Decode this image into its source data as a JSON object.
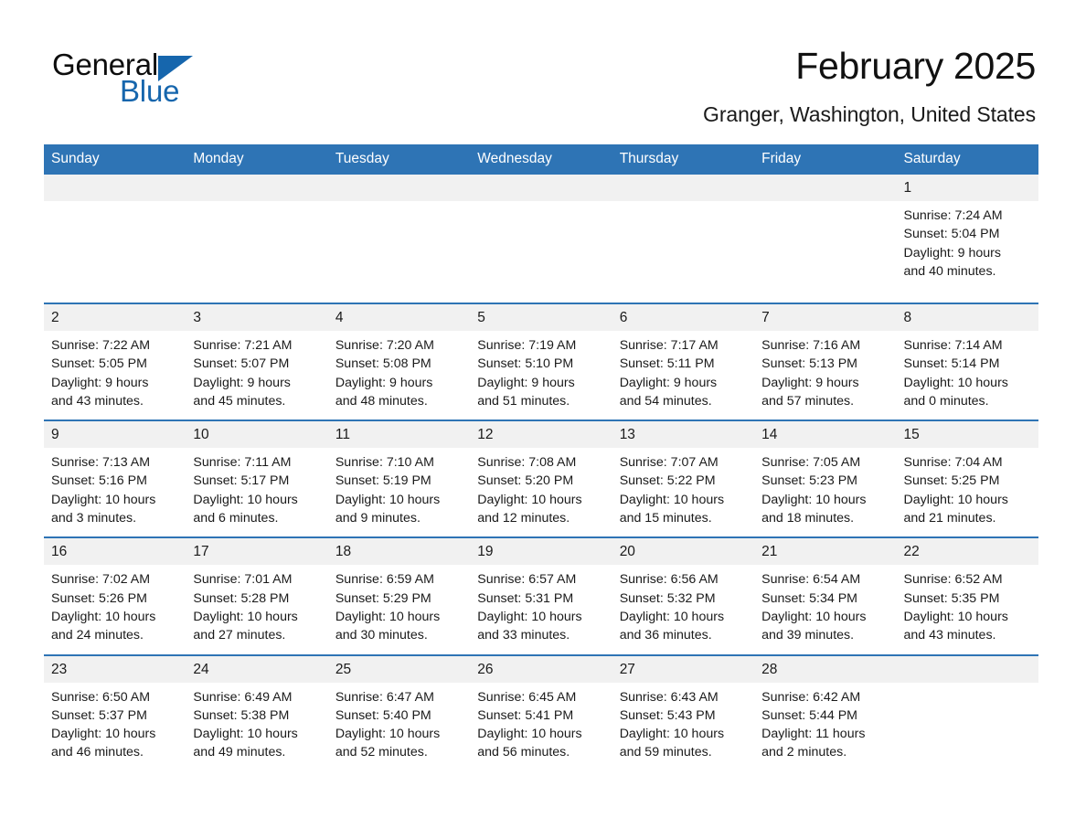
{
  "brand": {
    "name_part1": "General",
    "name_part2": "Blue",
    "triangle_color": "#1666ad"
  },
  "header": {
    "title": "February 2025",
    "subtitle": "Granger, Washington, United States"
  },
  "theme": {
    "header_blue": "#2e74b5",
    "daynum_gray": "#f1f1f1",
    "text": "#1a1a1a"
  },
  "weekday_headers": [
    "Sunday",
    "Monday",
    "Tuesday",
    "Wednesday",
    "Thursday",
    "Friday",
    "Saturday"
  ],
  "labels": {
    "sunrise_prefix": "Sunrise:",
    "sunset_prefix": "Sunset:",
    "daylight_prefix": "Daylight:"
  },
  "weeks": [
    [
      {
        "day": "",
        "blank": true
      },
      {
        "day": "",
        "blank": true
      },
      {
        "day": "",
        "blank": true
      },
      {
        "day": "",
        "blank": true
      },
      {
        "day": "",
        "blank": true
      },
      {
        "day": "",
        "blank": true
      },
      {
        "day": "1",
        "sunrise": "Sunrise: 7:24 AM",
        "sunset": "Sunset: 5:04 PM",
        "daylight_line1": "Daylight: 9 hours",
        "daylight_line2": "and 40 minutes."
      }
    ],
    [
      {
        "day": "2",
        "sunrise": "Sunrise: 7:22 AM",
        "sunset": "Sunset: 5:05 PM",
        "daylight_line1": "Daylight: 9 hours",
        "daylight_line2": "and 43 minutes."
      },
      {
        "day": "3",
        "sunrise": "Sunrise: 7:21 AM",
        "sunset": "Sunset: 5:07 PM",
        "daylight_line1": "Daylight: 9 hours",
        "daylight_line2": "and 45 minutes."
      },
      {
        "day": "4",
        "sunrise": "Sunrise: 7:20 AM",
        "sunset": "Sunset: 5:08 PM",
        "daylight_line1": "Daylight: 9 hours",
        "daylight_line2": "and 48 minutes."
      },
      {
        "day": "5",
        "sunrise": "Sunrise: 7:19 AM",
        "sunset": "Sunset: 5:10 PM",
        "daylight_line1": "Daylight: 9 hours",
        "daylight_line2": "and 51 minutes."
      },
      {
        "day": "6",
        "sunrise": "Sunrise: 7:17 AM",
        "sunset": "Sunset: 5:11 PM",
        "daylight_line1": "Daylight: 9 hours",
        "daylight_line2": "and 54 minutes."
      },
      {
        "day": "7",
        "sunrise": "Sunrise: 7:16 AM",
        "sunset": "Sunset: 5:13 PM",
        "daylight_line1": "Daylight: 9 hours",
        "daylight_line2": "and 57 minutes."
      },
      {
        "day": "8",
        "sunrise": "Sunrise: 7:14 AM",
        "sunset": "Sunset: 5:14 PM",
        "daylight_line1": "Daylight: 10 hours",
        "daylight_line2": "and 0 minutes."
      }
    ],
    [
      {
        "day": "9",
        "sunrise": "Sunrise: 7:13 AM",
        "sunset": "Sunset: 5:16 PM",
        "daylight_line1": "Daylight: 10 hours",
        "daylight_line2": "and 3 minutes."
      },
      {
        "day": "10",
        "sunrise": "Sunrise: 7:11 AM",
        "sunset": "Sunset: 5:17 PM",
        "daylight_line1": "Daylight: 10 hours",
        "daylight_line2": "and 6 minutes."
      },
      {
        "day": "11",
        "sunrise": "Sunrise: 7:10 AM",
        "sunset": "Sunset: 5:19 PM",
        "daylight_line1": "Daylight: 10 hours",
        "daylight_line2": "and 9 minutes."
      },
      {
        "day": "12",
        "sunrise": "Sunrise: 7:08 AM",
        "sunset": "Sunset: 5:20 PM",
        "daylight_line1": "Daylight: 10 hours",
        "daylight_line2": "and 12 minutes."
      },
      {
        "day": "13",
        "sunrise": "Sunrise: 7:07 AM",
        "sunset": "Sunset: 5:22 PM",
        "daylight_line1": "Daylight: 10 hours",
        "daylight_line2": "and 15 minutes."
      },
      {
        "day": "14",
        "sunrise": "Sunrise: 7:05 AM",
        "sunset": "Sunset: 5:23 PM",
        "daylight_line1": "Daylight: 10 hours",
        "daylight_line2": "and 18 minutes."
      },
      {
        "day": "15",
        "sunrise": "Sunrise: 7:04 AM",
        "sunset": "Sunset: 5:25 PM",
        "daylight_line1": "Daylight: 10 hours",
        "daylight_line2": "and 21 minutes."
      }
    ],
    [
      {
        "day": "16",
        "sunrise": "Sunrise: 7:02 AM",
        "sunset": "Sunset: 5:26 PM",
        "daylight_line1": "Daylight: 10 hours",
        "daylight_line2": "and 24 minutes."
      },
      {
        "day": "17",
        "sunrise": "Sunrise: 7:01 AM",
        "sunset": "Sunset: 5:28 PM",
        "daylight_line1": "Daylight: 10 hours",
        "daylight_line2": "and 27 minutes."
      },
      {
        "day": "18",
        "sunrise": "Sunrise: 6:59 AM",
        "sunset": "Sunset: 5:29 PM",
        "daylight_line1": "Daylight: 10 hours",
        "daylight_line2": "and 30 minutes."
      },
      {
        "day": "19",
        "sunrise": "Sunrise: 6:57 AM",
        "sunset": "Sunset: 5:31 PM",
        "daylight_line1": "Daylight: 10 hours",
        "daylight_line2": "and 33 minutes."
      },
      {
        "day": "20",
        "sunrise": "Sunrise: 6:56 AM",
        "sunset": "Sunset: 5:32 PM",
        "daylight_line1": "Daylight: 10 hours",
        "daylight_line2": "and 36 minutes."
      },
      {
        "day": "21",
        "sunrise": "Sunrise: 6:54 AM",
        "sunset": "Sunset: 5:34 PM",
        "daylight_line1": "Daylight: 10 hours",
        "daylight_line2": "and 39 minutes."
      },
      {
        "day": "22",
        "sunrise": "Sunrise: 6:52 AM",
        "sunset": "Sunset: 5:35 PM",
        "daylight_line1": "Daylight: 10 hours",
        "daylight_line2": "and 43 minutes."
      }
    ],
    [
      {
        "day": "23",
        "sunrise": "Sunrise: 6:50 AM",
        "sunset": "Sunset: 5:37 PM",
        "daylight_line1": "Daylight: 10 hours",
        "daylight_line2": "and 46 minutes."
      },
      {
        "day": "24",
        "sunrise": "Sunrise: 6:49 AM",
        "sunset": "Sunset: 5:38 PM",
        "daylight_line1": "Daylight: 10 hours",
        "daylight_line2": "and 49 minutes."
      },
      {
        "day": "25",
        "sunrise": "Sunrise: 6:47 AM",
        "sunset": "Sunset: 5:40 PM",
        "daylight_line1": "Daylight: 10 hours",
        "daylight_line2": "and 52 minutes."
      },
      {
        "day": "26",
        "sunrise": "Sunrise: 6:45 AM",
        "sunset": "Sunset: 5:41 PM",
        "daylight_line1": "Daylight: 10 hours",
        "daylight_line2": "and 56 minutes."
      },
      {
        "day": "27",
        "sunrise": "Sunrise: 6:43 AM",
        "sunset": "Sunset: 5:43 PM",
        "daylight_line1": "Daylight: 10 hours",
        "daylight_line2": "and 59 minutes."
      },
      {
        "day": "28",
        "sunrise": "Sunrise: 6:42 AM",
        "sunset": "Sunset: 5:44 PM",
        "daylight_line1": "Daylight: 11 hours",
        "daylight_line2": "and 2 minutes."
      },
      {
        "day": "",
        "blank": true
      }
    ]
  ]
}
